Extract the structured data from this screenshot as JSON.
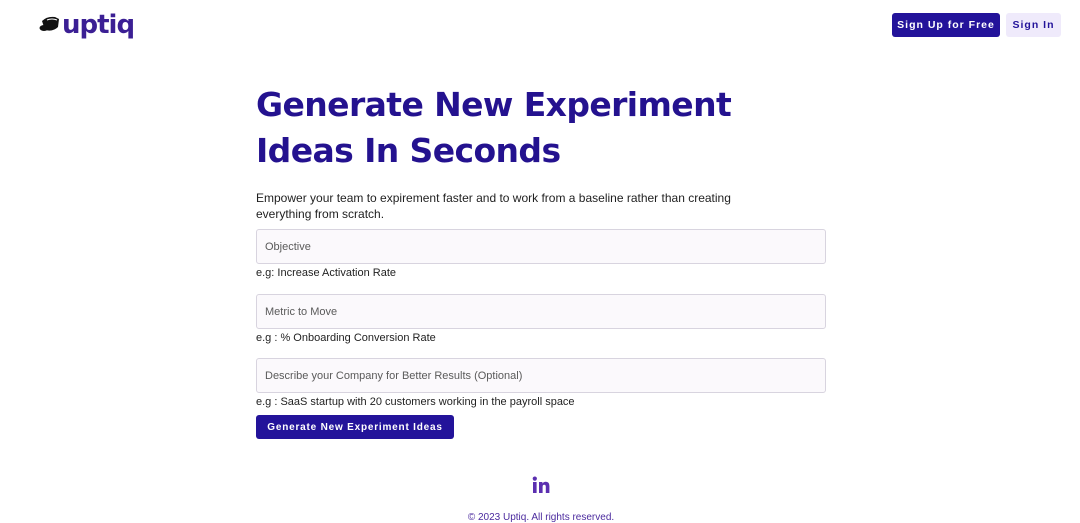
{
  "header": {
    "logo_text": "uptiq",
    "signup_label": "Sign Up for Free",
    "signin_label": "Sign In"
  },
  "main": {
    "title": "Generate New Experiment Ideas In Seconds",
    "subtitle": "Empower your team to expirement faster and to work from a baseline rather than creating everything from scratch.",
    "fields": [
      {
        "placeholder": "Objective",
        "value": "",
        "hint": "e.g: Increase Activation Rate"
      },
      {
        "placeholder": "Metric to Move",
        "value": "",
        "hint": "e.g : % Onboarding Conversion Rate"
      },
      {
        "placeholder": "Describe your Company for Better Results (Optional)",
        "value": "",
        "hint": "e.g : SaaS startup with 20 customers working in the payroll space"
      }
    ],
    "generate_label": "Generate New Experiment Ideas"
  },
  "footer": {
    "social_icon": "linkedin-icon",
    "copyright": "© 2023 Uptiq. All rights reserved."
  },
  "colors": {
    "brand": "#23139a",
    "logo": "#3b1f94",
    "secondary_button_bg": "#efeafb"
  }
}
